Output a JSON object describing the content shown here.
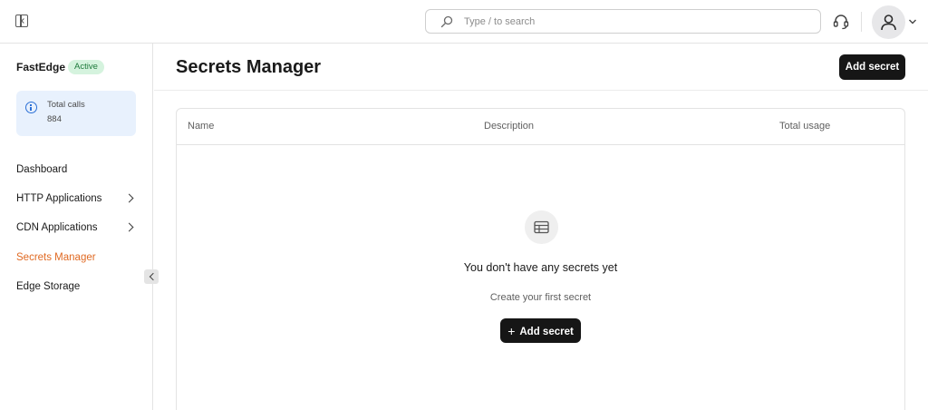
{
  "header": {
    "search_placeholder": "Type / to search",
    "icons": {
      "sidebar_toggle": "sidebar-toggle-icon",
      "search": "search-icon",
      "support": "headset-icon",
      "avatar": "user-icon",
      "avatar_menu": "chevron-down-icon"
    }
  },
  "sidebar": {
    "product": "FastEdge",
    "status_badge": "Active",
    "stats": {
      "label": "Total calls",
      "value": "884"
    },
    "items": [
      {
        "label": "Dashboard",
        "has_children": false,
        "active": false
      },
      {
        "label": "HTTP Applications",
        "has_children": true,
        "active": false
      },
      {
        "label": "CDN Applications",
        "has_children": true,
        "active": false
      },
      {
        "label": "Secrets Manager",
        "has_children": false,
        "active": true
      },
      {
        "label": "Edge Storage",
        "has_children": false,
        "active": false
      }
    ]
  },
  "main": {
    "title": "Secrets Manager",
    "add_button": "Add secret",
    "table": {
      "columns": [
        "Name",
        "Description",
        "Total usage"
      ],
      "rows": []
    },
    "empty_state": {
      "title": "You don't have any secrets yet",
      "subtitle": "Create your first secret",
      "button": "Add secret",
      "icon": "table-icon"
    }
  },
  "colors": {
    "accent": "#e06a23",
    "badge_bg": "#d5f3de",
    "badge_text": "#1f7a3c",
    "info_bg": "#e8f1fd",
    "button_dark": "#161616"
  }
}
